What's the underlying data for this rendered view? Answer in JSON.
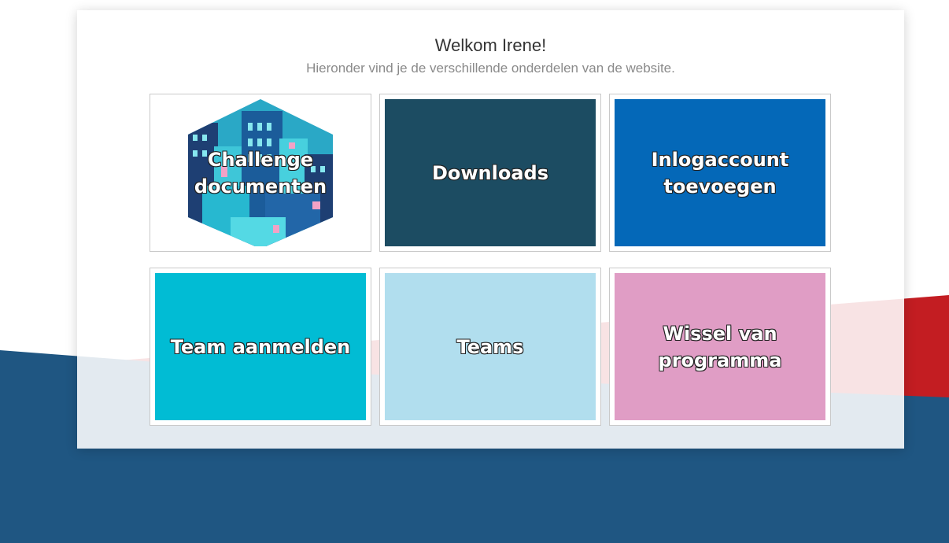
{
  "header": {
    "title": "Welkom Irene!",
    "subtitle": "Hieronder vind je de verschillende onderdelen van de website."
  },
  "tiles": [
    {
      "label": "Challenge documenten",
      "lines": [
        "Challenge",
        "documenten"
      ],
      "color": "#ffffff",
      "icon": "city-buildings-illustration"
    },
    {
      "label": "Downloads",
      "lines": [
        "Downloads"
      ],
      "color": "#1c4c62"
    },
    {
      "label": "Inlogaccount toevoegen",
      "lines": [
        "Inlogaccount",
        "toevoegen"
      ],
      "color": "#0468b8"
    },
    {
      "label": "Team aanmelden",
      "lines": [
        "Team aanmelden"
      ],
      "color": "#01bcd4"
    },
    {
      "label": "Teams",
      "lines": [
        "Teams"
      ],
      "color": "#b1deee"
    },
    {
      "label": "Wissel van programma",
      "lines": [
        "Wissel van",
        "programma"
      ],
      "color": "#e09dc5"
    }
  ],
  "background": {
    "colors": {
      "navy": "#1f5682",
      "red": "#c31d22",
      "pink": "#f7d6d8"
    }
  }
}
